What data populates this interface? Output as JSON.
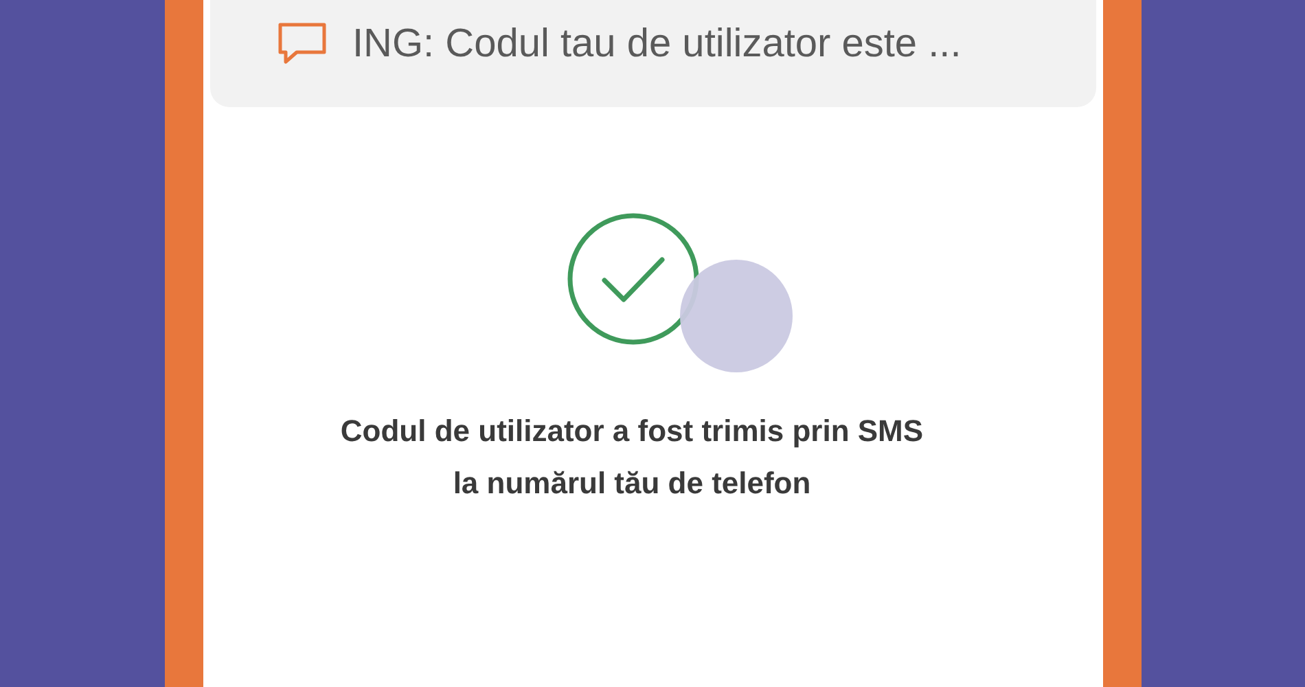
{
  "notification": {
    "text": "ING: Codul tau de utilizator este ..."
  },
  "confirmation": {
    "message": "Codul de utilizator a fost trimis prin SMS la numărul tău de telefon"
  }
}
